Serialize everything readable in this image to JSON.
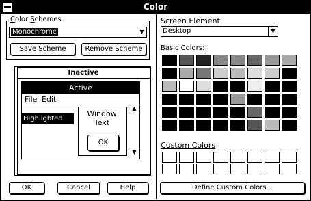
{
  "window": {
    "title": "Color"
  },
  "left": {
    "schemes_label_pre": "",
    "schemes_label_u": "C",
    "schemes_label_post": "olor ",
    "schemes_label_u2": "S",
    "schemes_label_post2": "chemes",
    "scheme_value": "Monochrome",
    "save_label": "Save Scheme",
    "remove_label": "Remove Scheme",
    "preview": {
      "inactive_title": "Inactive",
      "active_title": "Active",
      "menu_file": "File",
      "menu_edit": "Edit",
      "highlighted": "Highlighted",
      "window_text_line1": "Window",
      "window_text_line2": "Text",
      "ok": "OK"
    }
  },
  "right": {
    "screen_element_label": "Screen Element",
    "screen_element_value": "Desktop",
    "basic_colors_label": "Basic Colors:",
    "custom_colors_label": "Custom Colors",
    "define_label": "Define Custom Colors..."
  },
  "bottom": {
    "ok": "OK",
    "cancel": "Cancel",
    "help": "Help"
  },
  "colors": {
    "title_bg": "#000000",
    "window_bg": "#ffffff",
    "text": "#000000"
  },
  "swatches": [
    [
      "#000000",
      "#555555",
      "#222222",
      "#888888",
      "#888888",
      "#666666",
      "#999999",
      "#aaaaaa"
    ],
    [
      "#000000",
      "#aaaaaa",
      "#777777",
      "#cccccc",
      "#bbbbbb",
      "#dddddd",
      "#cccccc",
      "#000000"
    ],
    [
      "#bbbbbb",
      "#ffffff",
      "#dddddd",
      "#000000",
      "#000000",
      "#eeeeee",
      "#000000",
      "#000000"
    ],
    [
      "#000000",
      "#000000",
      "#000000",
      "#000000",
      "#999999",
      "#000000",
      "#000000",
      "#000000"
    ],
    [
      "#000000",
      "#000000",
      "#000000",
      "#000000",
      "#000000",
      "#666666",
      "#000000",
      "#000000"
    ],
    [
      "#000000",
      "#000000",
      "#000000",
      "#000000",
      "#000000",
      "#555555",
      "#bbbbbb",
      "#000000"
    ]
  ]
}
